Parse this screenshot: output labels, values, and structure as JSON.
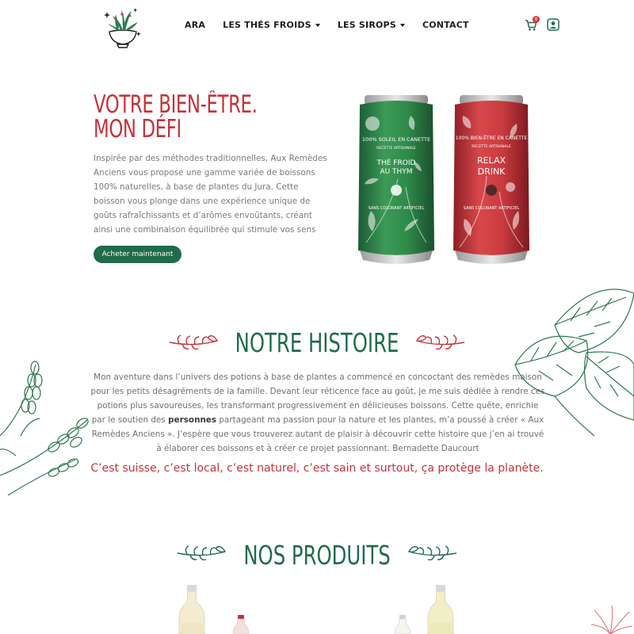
{
  "header": {
    "nav": [
      {
        "label": "ARA",
        "has_caret": false
      },
      {
        "label": "LES THÉS FROIDS",
        "has_caret": true
      },
      {
        "label": "LES SIROPS",
        "has_caret": true
      },
      {
        "label": "CONTACT",
        "has_caret": false
      }
    ],
    "cart_count": "0",
    "cart_icon": "cart-icon",
    "account_icon": "account-icon"
  },
  "hero": {
    "title_line1": "VOTRE BIEN-ÊTRE.",
    "title_line2": "MON DÉFI",
    "paragraph": "Inspirée par des méthodes traditionnelles, Aux Remèdes Anciens vous propose une gamme variée de boissons 100% naturelles, à base de plantes du Jura. Cette boisson vous plonge dans une expérience unique de goûts rafraîchissants et d’arômes envoûtants, créant ainsi une combinaison équilibrée qui stimule vos sens",
    "button_label": "Acheter maintenant",
    "can_green": {
      "top_text": "100% SOLEIL EN CANETTE",
      "sub_text": "RECETTE ARTISANALE",
      "name_line1": "THÉ FROID",
      "name_line2": "AU THYM",
      "side_text": "SANS COLORANT ARTIFICIEL"
    },
    "can_red": {
      "top_text": "100% BIEN-ÊTRE EN CANETTE",
      "sub_text": "RECETTE ARTISANALE",
      "name_line1": "RELAX",
      "name_line2": "DRINK",
      "side_text": "SANS COLORANT ARTIFICIEL"
    }
  },
  "history": {
    "title": "NOTRE HISTOIRE",
    "body_part1": "Mon aventure dans l’univers des potions à base de plantes a commencé en concoctant des remèdes maison pour les petits désagréments de la famille. Devant leur réticence face au goût, je me suis dédiée à rendre ces potions plus savoureuses, les transformant progressivement en délicieuses boissons. Cette quête, enrichie par le soutien des ",
    "body_bold": "personnes",
    "body_part2": " partageant ma passion pour la nature et les plantes, m’a poussé à créer « Aux Remèdes Anciens ». J’espère que vous trouverez autant de plaisir à découvrir cette histoire que j’en ai trouvé à élaborer ces boissons et à créer ce projet passionnant. Bernadette Daucourt",
    "slogan": "C’est suisse, c’est local, c’est naturel, c’est sain et surtout, ça protège la planète."
  },
  "products": {
    "title": "NOS PRODUITS"
  },
  "colors": {
    "brand_green": "#1f6b4b",
    "brand_red": "#c5323a",
    "text_gray": "#6f6f6f"
  }
}
